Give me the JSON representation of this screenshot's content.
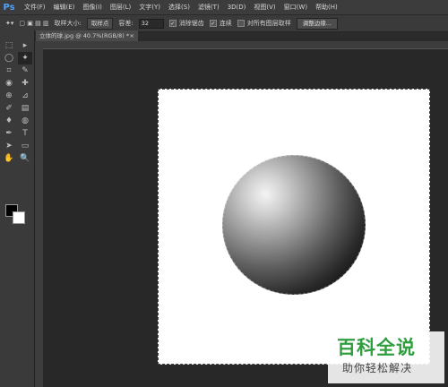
{
  "app": {
    "logo": "Ps"
  },
  "menu": [
    "文件(F)",
    "编辑(E)",
    "图像(I)",
    "图层(L)",
    "文字(Y)",
    "选择(S)",
    "滤镜(T)",
    "3D(D)",
    "视图(V)",
    "窗口(W)",
    "帮助(H)"
  ],
  "options": {
    "size_label": "取样大小:",
    "size_value": "取样点",
    "tolerance_label": "容差:",
    "tolerance_value": "32",
    "antialias_label": "消除锯齿",
    "contiguous_label": "连续",
    "sample_all_label": "对所有图层取样",
    "refine_button": "调整边缘..."
  },
  "document_tab": {
    "title": "立体的球.jpg @ 40.7%(RGB/8) *",
    "close": "×"
  },
  "tools": [
    "⬚",
    "▸",
    "◯",
    "✦",
    "⌗",
    "✎",
    "◉",
    "✚",
    "⊕",
    "⊿",
    "✐",
    "▤",
    "♦",
    "◍",
    "✒",
    "T",
    "➤",
    "▭",
    "✋",
    "🔍"
  ],
  "colors": {
    "foreground": "#000000",
    "background": "#ffffff"
  },
  "watermark": {
    "title": "百科全说",
    "subtitle": "助你轻松解决"
  }
}
